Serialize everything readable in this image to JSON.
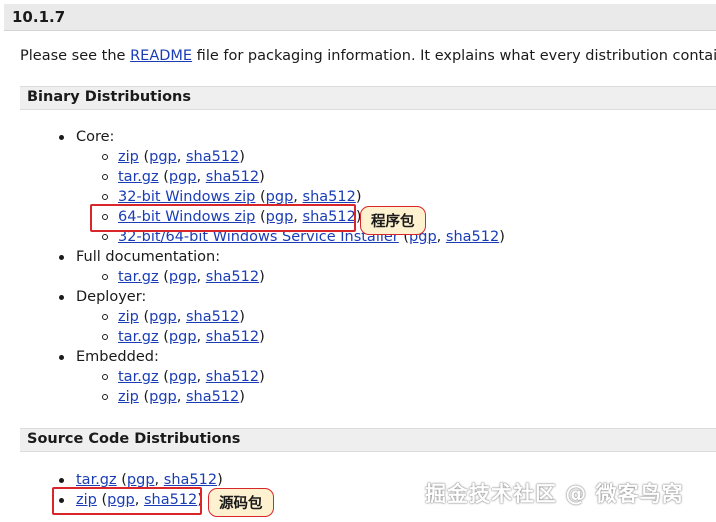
{
  "version_title": "10.1.7",
  "intro": {
    "before": "Please see the ",
    "link": "README",
    "after": " file for packaging information. It explains what every distribution contains."
  },
  "binary_section_title": "Binary Distributions",
  "source_section_title": "Source Code Distributions",
  "core": {
    "label": "Core:",
    "items": [
      {
        "name": "zip",
        "pgp": "pgp",
        "sha": "sha512"
      },
      {
        "name": "tar.gz",
        "pgp": "pgp",
        "sha": "sha512"
      },
      {
        "name": "32-bit Windows zip",
        "pgp": "pgp",
        "sha": "sha512"
      },
      {
        "name": "64-bit Windows zip",
        "pgp": "pgp",
        "sha": "sha512"
      },
      {
        "name": "32-bit/64-bit Windows Service Installer",
        "pgp": "pgp",
        "sha": "sha512"
      }
    ]
  },
  "full_docs": {
    "label": "Full documentation:",
    "items": [
      {
        "name": "tar.gz",
        "pgp": "pgp",
        "sha": "sha512"
      }
    ]
  },
  "deployer": {
    "label": "Deployer:",
    "items": [
      {
        "name": "zip",
        "pgp": "pgp",
        "sha": "sha512"
      },
      {
        "name": "tar.gz",
        "pgp": "pgp",
        "sha": "sha512"
      }
    ]
  },
  "embedded": {
    "label": "Embedded:",
    "items": [
      {
        "name": "tar.gz",
        "pgp": "pgp",
        "sha": "sha512"
      },
      {
        "name": "zip",
        "pgp": "pgp",
        "sha": "sha512"
      }
    ]
  },
  "source": {
    "items": [
      {
        "name": "tar.gz",
        "pgp": "pgp",
        "sha": "sha512"
      },
      {
        "name": "zip",
        "pgp": "pgp",
        "sha": "sha512"
      }
    ]
  },
  "callouts": {
    "binary": "程序包",
    "source": "源码包"
  },
  "watermark": "掘金技术社区 @ 微客鸟窝",
  "colors": {
    "link": "#1a3db6",
    "highlight": "#d9262a",
    "callout_bg": "#fdf1d0"
  }
}
